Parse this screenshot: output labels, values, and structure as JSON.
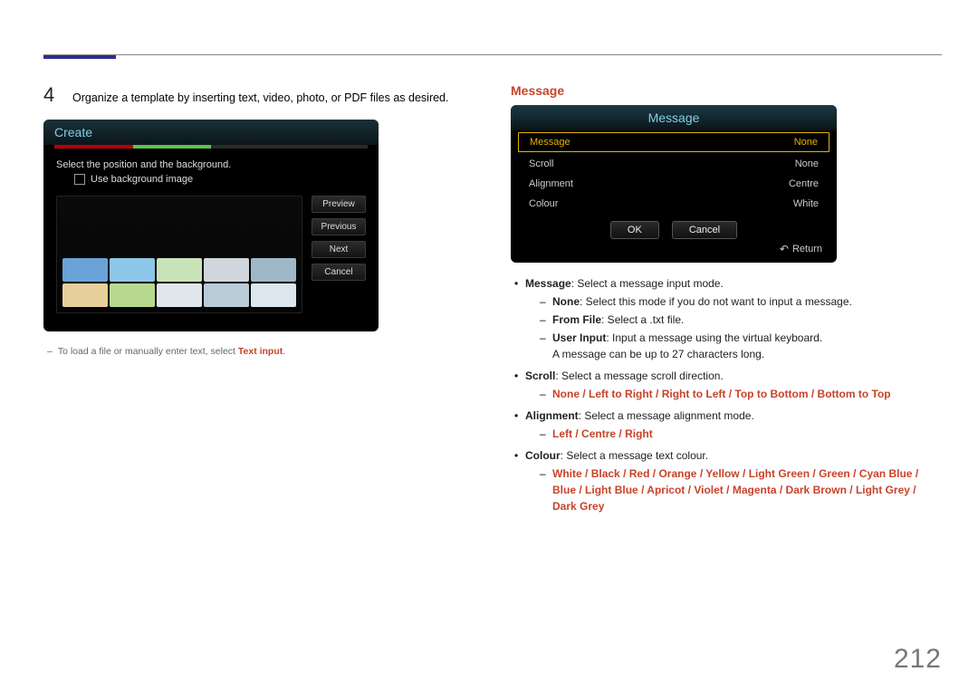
{
  "left": {
    "step_number": "4",
    "step_text": "Organize a template by inserting text, video, photo, or PDF files as desired.",
    "create": {
      "title": "Create",
      "subtitle": "Select the position and the background.",
      "checkbox_label": "Use background image",
      "buttons": {
        "preview": "Preview",
        "previous": "Previous",
        "next": "Next",
        "cancel": "Cancel"
      }
    },
    "footnote_prefix": "To load a file or manually enter text, select ",
    "footnote_emph": "Text input",
    "footnote_suffix": "."
  },
  "right": {
    "section_title": "Message",
    "panel": {
      "title": "Message",
      "rows": {
        "message": {
          "label": "Message",
          "value": "None"
        },
        "scroll": {
          "label": "Scroll",
          "value": "None"
        },
        "alignment": {
          "label": "Alignment",
          "value": "Centre"
        },
        "colour": {
          "label": "Colour",
          "value": "White"
        }
      },
      "ok": "OK",
      "cancel": "Cancel",
      "return": "Return"
    },
    "doc": {
      "message": {
        "term": "Message",
        "desc": ": Select a message input mode."
      },
      "message_sub": {
        "none": {
          "term": "None",
          "desc": ": Select this mode if you do not want to input a message."
        },
        "from_file": {
          "term": "From File",
          "desc": ": Select a .txt file."
        },
        "user_input": {
          "term": "User Input",
          "desc": ": Input a message using the virtual keyboard."
        },
        "user_input_extra": "A message can be up to 27 characters long."
      },
      "scroll": {
        "term": "Scroll",
        "desc": ": Select a message scroll direction."
      },
      "scroll_opts": [
        "None",
        "Left to Right",
        "Right to Left",
        "Top to Bottom",
        "Bottom to Top"
      ],
      "alignment": {
        "term": "Alignment",
        "desc": ": Select a message alignment mode."
      },
      "alignment_opts": [
        "Left",
        "Centre",
        "Right"
      ],
      "colour": {
        "term": "Colour",
        "desc": ": Select a message text colour."
      },
      "colour_opts": [
        "White",
        "Black",
        "Red",
        "Orange",
        "Yellow",
        "Light Green",
        "Green",
        "Cyan Blue",
        "Blue",
        "Light Blue",
        "Apricot",
        "Violet",
        "Magenta",
        "Dark Brown",
        "Light Grey",
        "Dark Grey"
      ]
    }
  },
  "page_number": "212",
  "thumb_colors": [
    "#6aa3d8",
    "#8cc7e8",
    "#c9e3b8",
    "#cfd6dd",
    "#9fb8c9",
    "#e6cf9a",
    "#b7d98f",
    "#e0e6ec",
    "#b8ccd8",
    "#dce6ee"
  ]
}
